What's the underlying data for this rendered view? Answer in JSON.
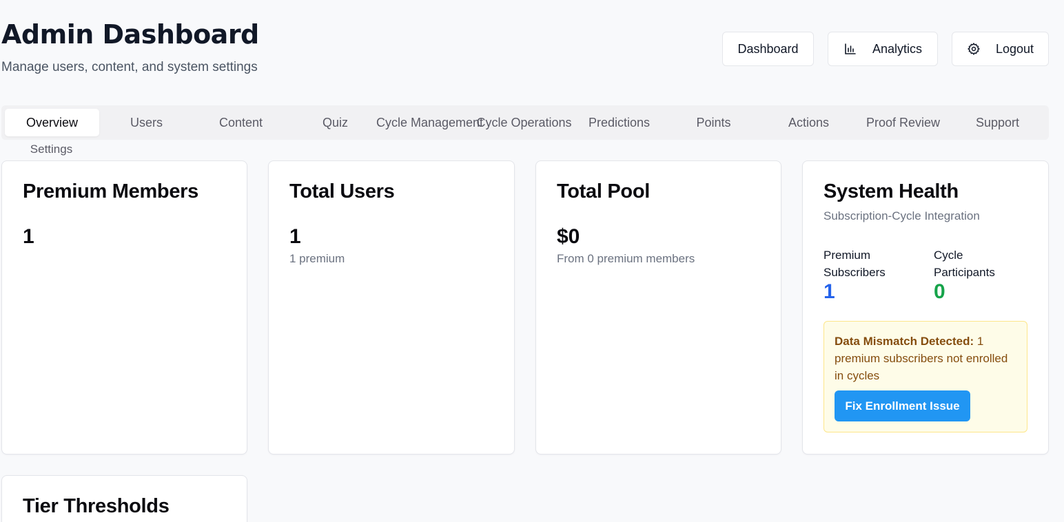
{
  "header": {
    "title": "Admin Dashboard",
    "subtitle": "Manage users, content, and system settings",
    "buttons": {
      "dashboard": "Dashboard",
      "analytics": "Analytics",
      "logout": "Logout"
    }
  },
  "tabs": [
    {
      "label": "Overview",
      "active": true
    },
    {
      "label": "Users"
    },
    {
      "label": "Content"
    },
    {
      "label": "Quiz"
    },
    {
      "label": "Cycle Management"
    },
    {
      "label": "Cycle Operations"
    },
    {
      "label": "Predictions"
    },
    {
      "label": "Points"
    },
    {
      "label": "Actions"
    },
    {
      "label": "Proof Review"
    },
    {
      "label": "Support"
    },
    {
      "label": "Settings"
    }
  ],
  "cards": {
    "premium_members": {
      "title": "Premium Members",
      "value": "1"
    },
    "total_users": {
      "title": "Total Users",
      "value": "1",
      "note": "1 premium"
    },
    "total_pool": {
      "title": "Total Pool",
      "value": "$0",
      "note": "From 0 premium members"
    },
    "tier_thresholds": {
      "title": "Tier Thresholds"
    }
  },
  "system_health": {
    "title": "System Health",
    "subtitle": "Subscription-Cycle Integration",
    "premium_subscribers_label_1": "Premium",
    "premium_subscribers_label_2": "Subscribers",
    "premium_subscribers_value": "1",
    "cycle_participants_label_1": "Cycle",
    "cycle_participants_label_2": "Participants",
    "cycle_participants_value": "0",
    "alert_heading": "Data Mismatch Detected:",
    "alert_body": " 1 premium subscribers not enrolled in cycles",
    "fix_button": "Fix Enrollment Issue"
  },
  "colors": {
    "accent_blue": "#2563eb",
    "accent_green": "#16a34a",
    "button_blue": "#2196f3",
    "alert_bg": "#fefce8",
    "alert_text": "#854d0e"
  },
  "icons": {
    "analytics": "bar-chart-icon",
    "logout": "gear-icon"
  }
}
